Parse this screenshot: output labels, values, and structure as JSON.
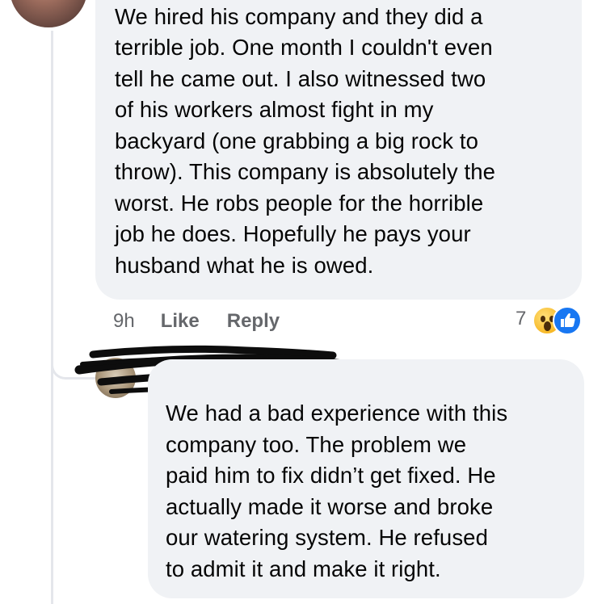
{
  "comment1": {
    "lines": [
      "We hired his company and they did a",
      "terrible job. One month I couldn't even",
      "tell he came out. I also witnessed two",
      "of his workers almost fight in my",
      "backyard (one grabbing a big rock to",
      "throw). This company is absolutely the",
      "worst. He robs people for the horrible",
      "job he does. Hopefully he pays your",
      "husband what he is owed."
    ],
    "time": "9h",
    "like_label": "Like",
    "reply_label": "Reply",
    "reaction_count": "7",
    "reactions": [
      "wow-icon",
      "like-icon"
    ]
  },
  "comment2": {
    "lines": [
      "We had a bad experience with this",
      "company too. The problem we",
      "paid him to fix didn’t get fixed. He",
      "actually made it worse and broke",
      "our watering system.  He refused",
      "to admit it and make it right."
    ]
  },
  "colors": {
    "bubble": "#f0f2f5",
    "meta_text": "#65676b",
    "like_blue": "#1877f2",
    "wow_yellow": "#f7b928",
    "redaction": "#0d0d0d"
  }
}
